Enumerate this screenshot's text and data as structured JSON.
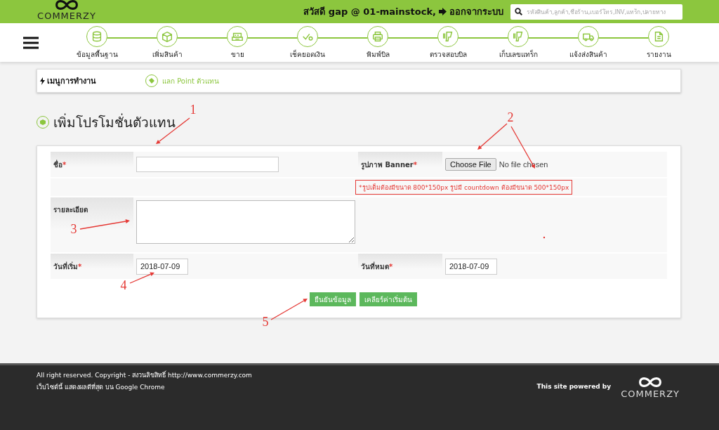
{
  "header": {
    "logo_text": "COMMERZY",
    "greeting": "สวัสดี gap @ 01-mainstock,",
    "logout": "ออกจากระบบ",
    "search": {
      "placeholder": "รหัสสินค้า,ลูกค้า,ชื่อร้าน,เบอร์โทร,INV,แทร็ก,ปลายทาง"
    }
  },
  "nav": {
    "items": [
      {
        "label": "ข้อมูลพื้นฐาน"
      },
      {
        "label": "เพิ่มสินค้า"
      },
      {
        "label": "ขาย"
      },
      {
        "label": "เช็คยอดเงิน"
      },
      {
        "label": "พิมพ์บิล"
      },
      {
        "label": "ตรวจสอบบิล"
      },
      {
        "label": "เก็บเลขแทร็ก"
      },
      {
        "label": "แจ้งส่งสินค้า"
      },
      {
        "label": "รายงาน"
      }
    ]
  },
  "menu": {
    "title": "เมนูการทำงาน",
    "links": [
      {
        "label": "แลก Point ตัวแทน"
      }
    ]
  },
  "page_title": "เพิ่มโปรโมชั่นตัวแทน",
  "form": {
    "name": {
      "label": "ชื่อ",
      "mark": "*"
    },
    "banner": {
      "label": "รูปภาพ Banner",
      "mark": "*",
      "button": "Choose File",
      "status": "No file chosen"
    },
    "hint": "*รูปเต็มต้องมีขนาด 800*150px รูปมี countdown ต้องมีขนาด 500*150px",
    "detail": {
      "label": "รายละเอียด"
    },
    "start": {
      "label": "วันที่เริ่ม",
      "mark": "*",
      "value": "2018-07-09"
    },
    "end": {
      "label": "วันที่หมด",
      "mark": "*",
      "value": "2018-07-09"
    },
    "buttons": [
      "ยืนยันข้อมูล",
      "เคลียร์ค่าเริ่มต้น"
    ]
  },
  "footer": {
    "lines": [
      "All right reserved. Copyright - สงวนลิขสิทธิ์ http://www.commerzy.com",
      "เว็บไซต์นี้ แสดงผลดีที่สุด บน Google Chrome"
    ],
    "powered_by": "This site powered by",
    "logo_text": "COMMERZY"
  },
  "annotations": [
    {
      "label": "1"
    },
    {
      "label": "2"
    },
    {
      "label": "3"
    },
    {
      "label": "4"
    },
    {
      "label": "5"
    }
  ]
}
